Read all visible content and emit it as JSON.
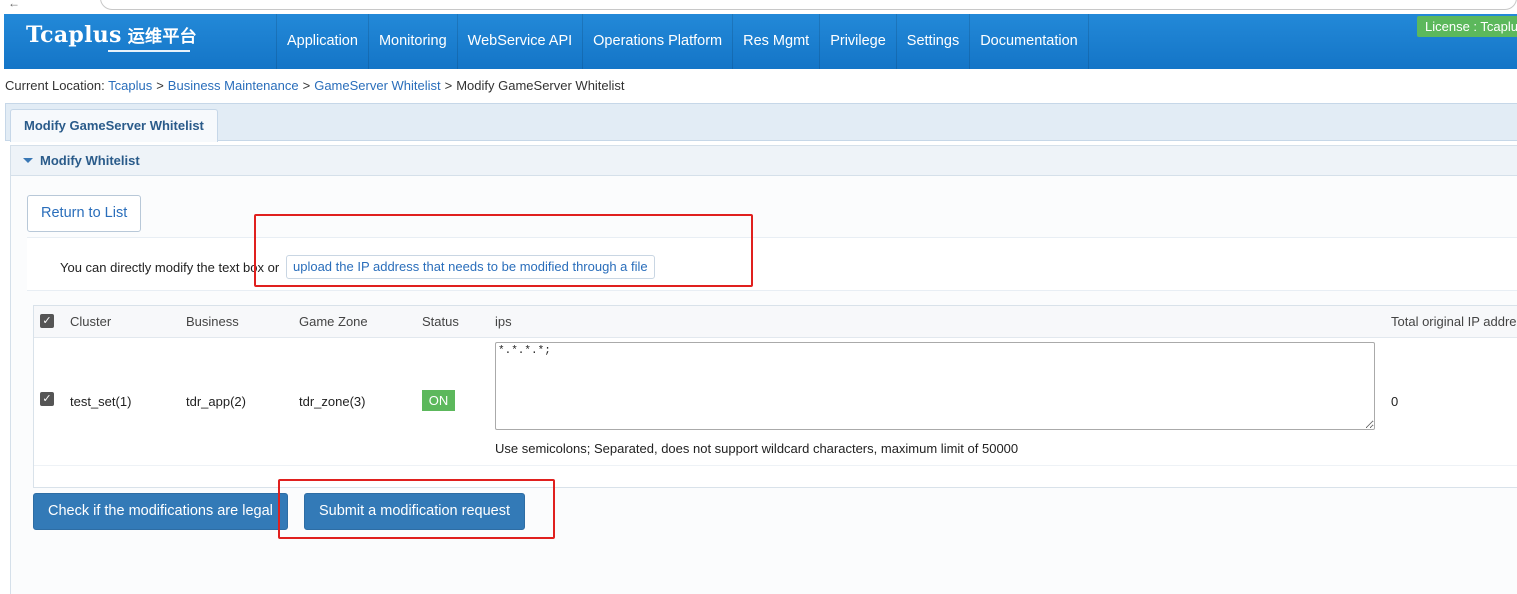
{
  "license": "License : Tcaplus",
  "logo": {
    "brand": "Tcaplus",
    "subtitle": "运维平台"
  },
  "nav": {
    "items": [
      {
        "label": "Application"
      },
      {
        "label": "Monitoring"
      },
      {
        "label": "WebService API"
      },
      {
        "label": "Operations Platform"
      },
      {
        "label": "Res Mgmt"
      },
      {
        "label": "Privilege"
      },
      {
        "label": "Settings"
      },
      {
        "label": "Documentation"
      }
    ]
  },
  "breadcrumb": {
    "prefix": "Current Location:",
    "items": [
      "Tcaplus",
      "Business Maintenance",
      "GameServer Whitelist"
    ],
    "current": "Modify GameServer Whitelist",
    "separator": ">"
  },
  "tab": {
    "label": "Modify GameServer Whitelist"
  },
  "panel": {
    "title": "Modify Whitelist"
  },
  "return_button": "Return to List",
  "info": {
    "text": "You can directly modify the text box or",
    "upload_link": "upload the IP address that needs to be modified through a file"
  },
  "table": {
    "headers": {
      "cluster": "Cluster",
      "business": "Business",
      "zone": "Game Zone",
      "status": "Status",
      "ips": "ips",
      "total": "Total original IP addre"
    },
    "rows": [
      {
        "cluster": "test_set(1)",
        "business": "tdr_app(2)",
        "zone": "tdr_zone(3)",
        "status": "ON",
        "ips": "*.*.*.*;",
        "total": "0",
        "checked": true
      }
    ],
    "hint": "Use semicolons; Separated, does not support wildcard characters, maximum limit of 50000"
  },
  "actions": {
    "check": "Check if the modifications are legal",
    "submit": "Submit a modification request"
  },
  "colors": {
    "navbar": "#1a7fd1",
    "license": "#5cb85c",
    "primary_button": "#337ab7",
    "status_on": "#5cb85c",
    "annotation": "#e0201e"
  }
}
